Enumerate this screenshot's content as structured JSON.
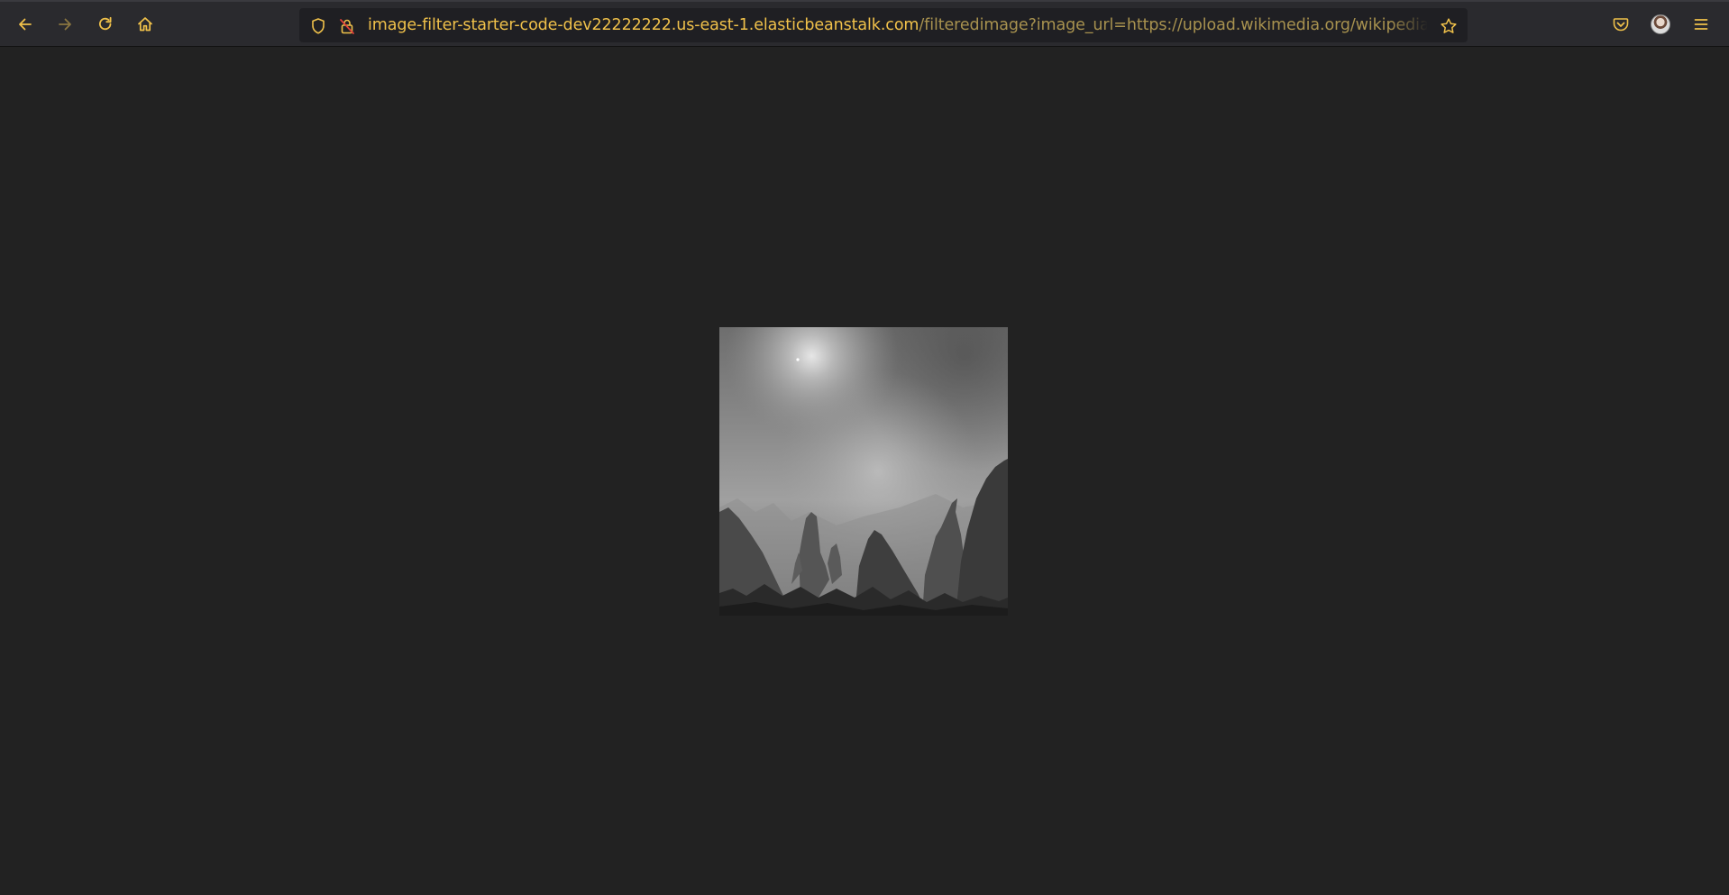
{
  "browser": {
    "nav": {
      "back_icon": "arrow-left-icon",
      "forward_icon": "arrow-right-icon",
      "reload_icon": "reload-icon",
      "home_icon": "home-icon"
    },
    "urlbar": {
      "shield_icon": "tracking-shield-icon",
      "lock_icon": "insecure-lock-icon",
      "host": "image-filter-starter-code-dev22222222.us-east-1.elasticbeanstalk.com",
      "path": "/filteredimage?image_url=https://upload.wikimedia.org/wikipedia",
      "bookmark_icon": "star-icon"
    },
    "right_toolbar": {
      "pocket_icon": "pocket-icon",
      "account_icon": "avatar",
      "menu_icon": "hamburger-menu-icon"
    },
    "colors": {
      "accent": "#f0c14a",
      "toolbar_bg": "#2a2a2e",
      "page_bg": "#222222"
    }
  },
  "content": {
    "image": "grayscale mountain fog landscape"
  }
}
